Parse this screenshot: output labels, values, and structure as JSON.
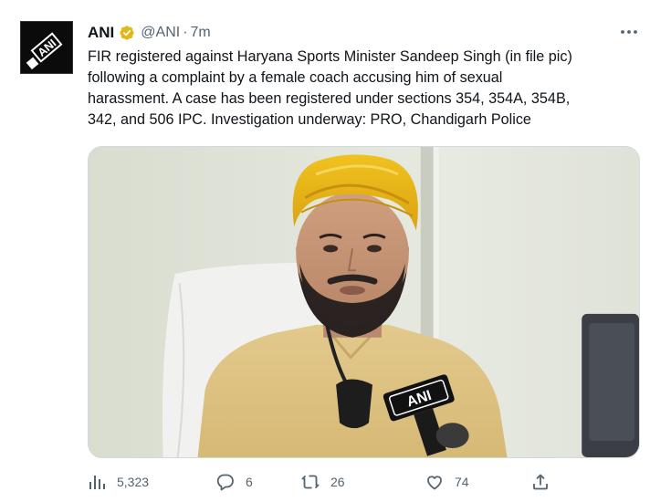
{
  "author": {
    "name": "ANI",
    "handle": "@ANI",
    "separator": "·",
    "time": "7m",
    "avatar_icon": "ani-logo-icon",
    "avatar_text": "ANI",
    "verified_color": "#e2b719"
  },
  "tweet": {
    "lines": [
      "FIR registered against Haryana Sports Minister Sandeep Singh (in file pic)",
      "following a complaint by a female coach accusing him of sexual",
      "harassment. A case has been registered under sections 354, 354A, 354B,",
      "342, and 506 IPC. Investigation underway: PRO, Chandigarh Police"
    ]
  },
  "media": {
    "mic_label": "ANI"
  },
  "actions": {
    "views": {
      "icon": "analytics-icon",
      "count": "5,323"
    },
    "replies": {
      "icon": "reply-icon",
      "count": "6"
    },
    "retweets": {
      "icon": "retweet-icon",
      "count": "26"
    },
    "likes": {
      "icon": "like-icon",
      "count": "74"
    },
    "share": {
      "icon": "share-icon"
    }
  },
  "colors": {
    "text": "#0f1419",
    "secondary": "#536471",
    "border": "#cfd9de"
  }
}
